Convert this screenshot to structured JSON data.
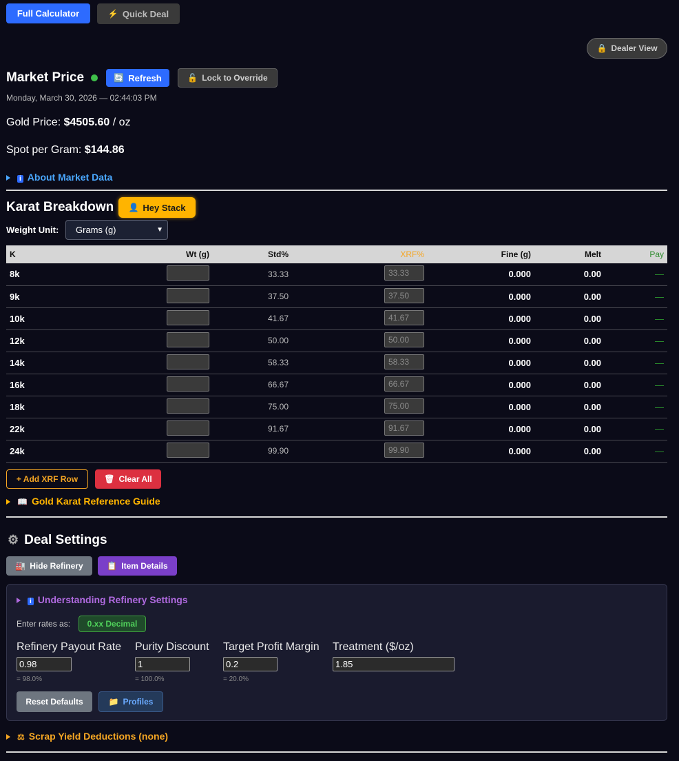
{
  "tabs": {
    "full_calculator": "Full Calculator",
    "quick_deal": "Quick Deal"
  },
  "dealer_view": "Dealer View",
  "market": {
    "title": "Market Price",
    "refresh": "Refresh",
    "lock": "Lock to Override",
    "datetime": "Monday, March 30, 2026 — 02:44:03 PM",
    "gold_label": "Gold Price:",
    "gold_value": "$4505.60",
    "gold_unit": "/ oz",
    "spot_label": "Spot per Gram:",
    "spot_value": "$144.86",
    "about": "About Market Data"
  },
  "karat": {
    "title": "Karat Breakdown",
    "hey_stack": "Hey Stack",
    "weight_unit_label": "Weight Unit:",
    "weight_unit_value": "Grams (g)",
    "headers": {
      "k": "K",
      "wt": "Wt (g)",
      "std": "Std%",
      "xrf": "XRF%",
      "fine": "Fine (g)",
      "melt": "Melt",
      "pay": "Pay"
    },
    "rows": [
      {
        "k": "8k",
        "std": "33.33",
        "xrf": "33.33",
        "fine": "0.000",
        "melt": "0.00",
        "pay": "—"
      },
      {
        "k": "9k",
        "std": "37.50",
        "xrf": "37.50",
        "fine": "0.000",
        "melt": "0.00",
        "pay": "—"
      },
      {
        "k": "10k",
        "std": "41.67",
        "xrf": "41.67",
        "fine": "0.000",
        "melt": "0.00",
        "pay": "—"
      },
      {
        "k": "12k",
        "std": "50.00",
        "xrf": "50.00",
        "fine": "0.000",
        "melt": "0.00",
        "pay": "—"
      },
      {
        "k": "14k",
        "std": "58.33",
        "xrf": "58.33",
        "fine": "0.000",
        "melt": "0.00",
        "pay": "—"
      },
      {
        "k": "16k",
        "std": "66.67",
        "xrf": "66.67",
        "fine": "0.000",
        "melt": "0.00",
        "pay": "—"
      },
      {
        "k": "18k",
        "std": "75.00",
        "xrf": "75.00",
        "fine": "0.000",
        "melt": "0.00",
        "pay": "—"
      },
      {
        "k": "22k",
        "std": "91.67",
        "xrf": "91.67",
        "fine": "0.000",
        "melt": "0.00",
        "pay": "—"
      },
      {
        "k": "24k",
        "std": "99.90",
        "xrf": "99.90",
        "fine": "0.000",
        "melt": "0.00",
        "pay": "—"
      }
    ],
    "add_xrf": "+ Add XRF Row",
    "clear_all": "Clear All",
    "reference_guide": "Gold Karat Reference Guide"
  },
  "deal": {
    "title": "Deal Settings",
    "hide_refinery": "Hide Refinery",
    "item_details": "Item Details",
    "understanding": "Understanding Refinery Settings",
    "enter_rates_label": "Enter rates as:",
    "decimal_badge": "0.xx Decimal",
    "payout_label": "Refinery Payout Rate",
    "payout_value": "0.98",
    "payout_hint": "= 98.0%",
    "purity_label": "Purity Discount",
    "purity_value": "1",
    "purity_hint": "= 100.0%",
    "margin_label": "Target Profit Margin",
    "margin_value": "0.2",
    "margin_hint": "= 20.0%",
    "treatment_label": "Treatment ($/oz)",
    "treatment_value": "1.85",
    "reset": "Reset Defaults",
    "profiles": "Profiles",
    "scrap_yield": "Scrap Yield Deductions (none)"
  },
  "colors": {
    "blue": "#2d6bff",
    "orange": "#f5a623",
    "gold": "#ffb400",
    "purple": "#7a3fc8",
    "green": "#3fa03f",
    "red": "#dc3040"
  },
  "icons": [
    "bolt-icon",
    "lock-icon",
    "refresh-icon",
    "unlock-icon",
    "info-icon",
    "person-icon",
    "book-icon",
    "gear-icon",
    "trash-icon",
    "clipboard-icon",
    "folder-icon",
    "scale-icon",
    "refinery-icon"
  ]
}
